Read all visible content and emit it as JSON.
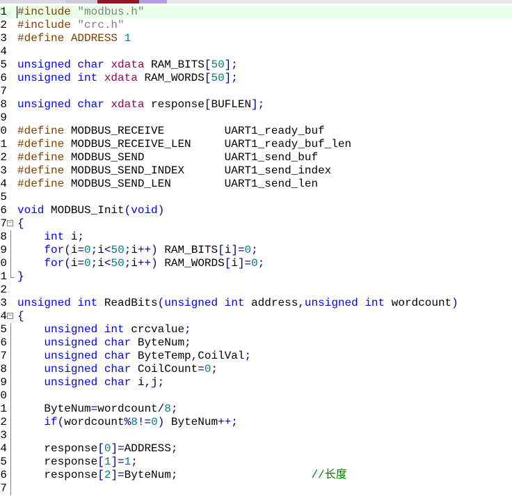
{
  "editor": {
    "line_numbers": [
      "1",
      "2",
      "3",
      "4",
      "5",
      "6",
      "7",
      "8",
      "9",
      "0",
      "1",
      "2",
      "3",
      "4",
      "5",
      "6",
      "7",
      "8",
      "9",
      "0",
      "1",
      "2",
      "3",
      "4",
      "5",
      "6",
      "7",
      "8",
      "9",
      "0",
      "1",
      "2",
      "3",
      "4",
      "5",
      "6",
      "7"
    ],
    "lines": [
      [
        [
          "pp",
          "#include "
        ],
        [
          "st",
          "\"modbus.h\""
        ]
      ],
      [
        [
          "pp",
          "#include "
        ],
        [
          "st",
          "\"crc.h\""
        ]
      ],
      [
        [
          "pp",
          "#define ADDRESS "
        ],
        [
          "nm",
          "1"
        ]
      ],
      [],
      [
        [
          "kw",
          "unsigned "
        ],
        [
          "kw",
          "char "
        ],
        [
          "xd",
          "xdata "
        ],
        [
          "id",
          "RAM_BITS"
        ],
        [
          "op",
          "["
        ],
        [
          "nm",
          "50"
        ],
        [
          "op",
          "];"
        ]
      ],
      [
        [
          "kw",
          "unsigned "
        ],
        [
          "kw",
          "int "
        ],
        [
          "xd",
          "xdata "
        ],
        [
          "id",
          "RAM_WORDS"
        ],
        [
          "op",
          "["
        ],
        [
          "nm",
          "50"
        ],
        [
          "op",
          "];"
        ]
      ],
      [],
      [
        [
          "kw",
          "unsigned "
        ],
        [
          "kw",
          "char "
        ],
        [
          "xd",
          "xdata "
        ],
        [
          "id",
          "response"
        ],
        [
          "op",
          "["
        ],
        [
          "id",
          "BUFLEN"
        ],
        [
          "op",
          "];"
        ]
      ],
      [],
      [
        [
          "pp",
          "#define "
        ],
        [
          "id",
          "MODBUS_RECEIVE         UART1_ready_buf"
        ]
      ],
      [
        [
          "pp",
          "#define "
        ],
        [
          "id",
          "MODBUS_RECEIVE_LEN     UART1_ready_buf_len"
        ]
      ],
      [
        [
          "pp",
          "#define "
        ],
        [
          "id",
          "MODBUS_SEND            UART1_send_buf"
        ]
      ],
      [
        [
          "pp",
          "#define "
        ],
        [
          "id",
          "MODBUS_SEND_INDEX      UART1_send_index"
        ]
      ],
      [
        [
          "pp",
          "#define "
        ],
        [
          "id",
          "MODBUS_SEND_LEN        UART1_send_len"
        ]
      ],
      [],
      [
        [
          "kw",
          "void "
        ],
        [
          "id",
          "MODBUS_Init"
        ],
        [
          "op",
          "("
        ],
        [
          "kw",
          "void"
        ],
        [
          "op",
          ")"
        ]
      ],
      [
        [
          "op",
          "{"
        ]
      ],
      [
        [
          "id",
          "    "
        ],
        [
          "kw",
          "int "
        ],
        [
          "id",
          "i"
        ],
        [
          "op",
          ";"
        ]
      ],
      [
        [
          "id",
          "    "
        ],
        [
          "kw",
          "for"
        ],
        [
          "op",
          "("
        ],
        [
          "id",
          "i"
        ],
        [
          "op",
          "="
        ],
        [
          "nm",
          "0"
        ],
        [
          "op",
          ";"
        ],
        [
          "id",
          "i"
        ],
        [
          "op",
          "<"
        ],
        [
          "nm",
          "50"
        ],
        [
          "op",
          ";"
        ],
        [
          "id",
          "i"
        ],
        [
          "op",
          "++) "
        ],
        [
          "id",
          "RAM_BITS"
        ],
        [
          "op",
          "["
        ],
        [
          "id",
          "i"
        ],
        [
          "op",
          "]="
        ],
        [
          "nm",
          "0"
        ],
        [
          "op",
          ";"
        ]
      ],
      [
        [
          "id",
          "    "
        ],
        [
          "kw",
          "for"
        ],
        [
          "op",
          "("
        ],
        [
          "id",
          "i"
        ],
        [
          "op",
          "="
        ],
        [
          "nm",
          "0"
        ],
        [
          "op",
          ";"
        ],
        [
          "id",
          "i"
        ],
        [
          "op",
          "<"
        ],
        [
          "nm",
          "50"
        ],
        [
          "op",
          ";"
        ],
        [
          "id",
          "i"
        ],
        [
          "op",
          "++) "
        ],
        [
          "id",
          "RAM_WORDS"
        ],
        [
          "op",
          "["
        ],
        [
          "id",
          "i"
        ],
        [
          "op",
          "]="
        ],
        [
          "nm",
          "0"
        ],
        [
          "op",
          ";"
        ]
      ],
      [
        [
          "op",
          "}"
        ]
      ],
      [],
      [
        [
          "kw",
          "unsigned "
        ],
        [
          "kw",
          "int "
        ],
        [
          "id",
          "ReadBits"
        ],
        [
          "op",
          "("
        ],
        [
          "kw",
          "unsigned "
        ],
        [
          "kw",
          "int "
        ],
        [
          "id",
          "address"
        ],
        [
          "op",
          ","
        ],
        [
          "kw",
          "unsigned "
        ],
        [
          "kw",
          "int "
        ],
        [
          "id",
          "wordcount"
        ],
        [
          "op",
          ")"
        ]
      ],
      [
        [
          "op",
          "{"
        ]
      ],
      [
        [
          "id",
          "    "
        ],
        [
          "kw",
          "unsigned "
        ],
        [
          "kw",
          "int "
        ],
        [
          "id",
          "crcvalue"
        ],
        [
          "op",
          ";"
        ]
      ],
      [
        [
          "id",
          "    "
        ],
        [
          "kw",
          "unsigned "
        ],
        [
          "kw",
          "char "
        ],
        [
          "id",
          "ByteNum"
        ],
        [
          "op",
          ";"
        ]
      ],
      [
        [
          "id",
          "    "
        ],
        [
          "kw",
          "unsigned "
        ],
        [
          "kw",
          "char "
        ],
        [
          "id",
          "ByteTemp"
        ],
        [
          "op",
          ","
        ],
        [
          "id",
          "CoilVal"
        ],
        [
          "op",
          ";"
        ]
      ],
      [
        [
          "id",
          "    "
        ],
        [
          "kw",
          "unsigned "
        ],
        [
          "kw",
          "char "
        ],
        [
          "id",
          "CoilCount"
        ],
        [
          "op",
          "="
        ],
        [
          "nm",
          "0"
        ],
        [
          "op",
          ";"
        ]
      ],
      [
        [
          "id",
          "    "
        ],
        [
          "kw",
          "unsigned "
        ],
        [
          "kw",
          "char "
        ],
        [
          "id",
          "i"
        ],
        [
          "op",
          ","
        ],
        [
          "id",
          "j"
        ],
        [
          "op",
          ";"
        ]
      ],
      [],
      [
        [
          "id",
          "    ByteNum"
        ],
        [
          "op",
          "="
        ],
        [
          "id",
          "wordcount"
        ],
        [
          "op",
          "/"
        ],
        [
          "nm",
          "8"
        ],
        [
          "op",
          ";"
        ]
      ],
      [
        [
          "id",
          "    "
        ],
        [
          "kw",
          "if"
        ],
        [
          "op",
          "("
        ],
        [
          "id",
          "wordcount"
        ],
        [
          "op",
          "%"
        ],
        [
          "nm",
          "8"
        ],
        [
          "op",
          "!="
        ],
        [
          "nm",
          "0"
        ],
        [
          "op",
          ") "
        ],
        [
          "id",
          "ByteNum"
        ],
        [
          "op",
          "++;"
        ]
      ],
      [],
      [
        [
          "id",
          "    response"
        ],
        [
          "op",
          "["
        ],
        [
          "nm",
          "0"
        ],
        [
          "op",
          "]="
        ],
        [
          "id",
          "ADDRESS"
        ],
        [
          "op",
          ";"
        ]
      ],
      [
        [
          "id",
          "    response"
        ],
        [
          "op",
          "["
        ],
        [
          "nm",
          "1"
        ],
        [
          "op",
          "]="
        ],
        [
          "nm",
          "1"
        ],
        [
          "op",
          ";"
        ]
      ],
      [
        [
          "id",
          "    response"
        ],
        [
          "op",
          "["
        ],
        [
          "nm",
          "2"
        ],
        [
          "op",
          "]="
        ],
        [
          "id",
          "ByteNum"
        ],
        [
          "op",
          ";"
        ],
        [
          "id",
          "                    "
        ],
        [
          "cm",
          "//长度"
        ]
      ],
      []
    ],
    "fold_markers": {
      "16": "box",
      "17": "line",
      "18": "line",
      "19": "line",
      "20": "end",
      "23": "box",
      "24": "line",
      "25": "line",
      "26": "line",
      "27": "line",
      "28": "line",
      "29": "line",
      "30": "line",
      "31": "line",
      "32": "line",
      "33": "line",
      "34": "line",
      "35": "line",
      "36": "line"
    },
    "fold_glyph": "⊟",
    "current_line": 0
  }
}
